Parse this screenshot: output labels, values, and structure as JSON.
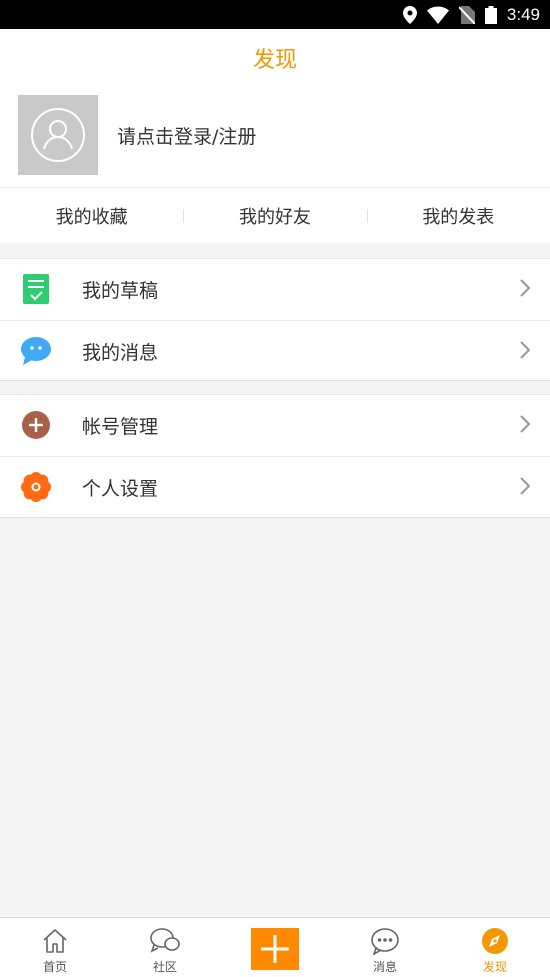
{
  "status_bar": {
    "time": "3:49"
  },
  "header": {
    "title": "发现"
  },
  "profile": {
    "login_prompt": "请点击登录/注册"
  },
  "shortcuts": [
    {
      "label": "我的收藏"
    },
    {
      "label": "我的好友"
    },
    {
      "label": "我的发表"
    }
  ],
  "menu_groups": [
    [
      {
        "label": "我的草稿",
        "icon": "draft-icon",
        "color": "#2ecc71"
      },
      {
        "label": "我的消息",
        "icon": "message-bubble-icon",
        "color": "#3fa9f5"
      }
    ],
    [
      {
        "label": "帐号管理",
        "icon": "account-plus-icon",
        "color": "#a9604a"
      },
      {
        "label": "个人设置",
        "icon": "settings-flower-icon",
        "color": "#ff6a13"
      }
    ]
  ],
  "tabs": [
    {
      "label": "首页",
      "icon": "home-icon"
    },
    {
      "label": "社区",
      "icon": "community-icon"
    },
    {
      "label": "",
      "icon": "plus-icon"
    },
    {
      "label": "消息",
      "icon": "chat-icon"
    },
    {
      "label": "发现",
      "icon": "compass-icon",
      "active": true
    }
  ],
  "colors": {
    "accent": "#f39800",
    "plus_button": "#ff8a00"
  }
}
